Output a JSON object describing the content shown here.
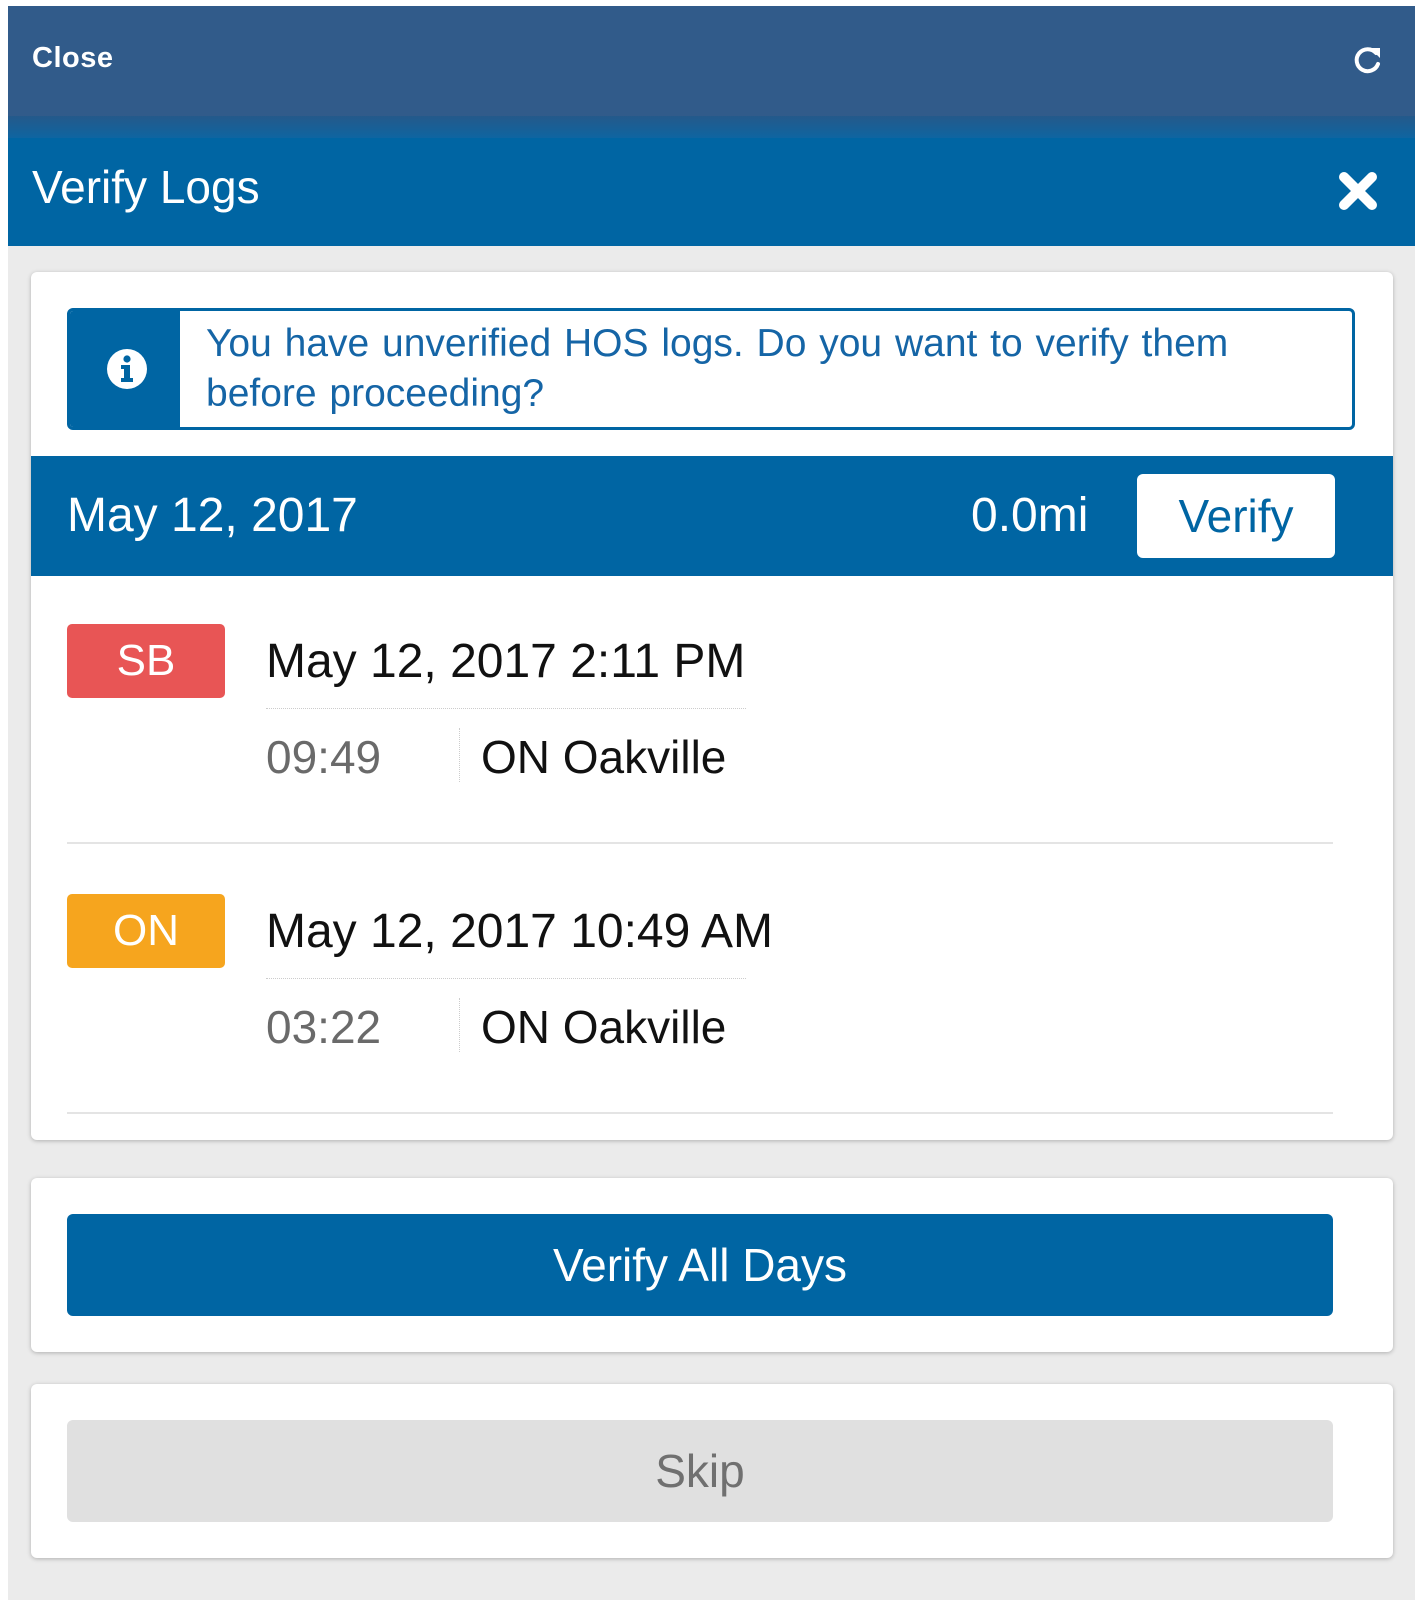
{
  "topbar": {
    "close_label": "Close",
    "refresh_icon": "refresh-icon"
  },
  "dialog": {
    "title": "Verify Logs",
    "close_icon": "close-icon"
  },
  "alert": {
    "icon": "info-icon",
    "message": "You have unverified HOS logs. Do you want to verify them before  proceeding?"
  },
  "day": {
    "date": "May 12, 2017",
    "distance": "0.0mi",
    "verify_label": "Verify"
  },
  "entries": [
    {
      "status": "SB",
      "status_color": "#e85555",
      "datetime": "May 12, 2017 2:11 PM",
      "duration": "09:49",
      "location": "ON Oakville"
    },
    {
      "status": "ON",
      "status_color": "#f6a51e",
      "datetime": "May 12, 2017 10:49 AM",
      "duration": "03:22",
      "location": "ON Oakville"
    }
  ],
  "actions": {
    "verify_all_label": "Verify All Days",
    "skip_label": "Skip"
  },
  "colors": {
    "topbar": "#315b8a",
    "primary": "#0065a3",
    "background": "#ebebeb",
    "skip_button": "#e0e0e0"
  }
}
